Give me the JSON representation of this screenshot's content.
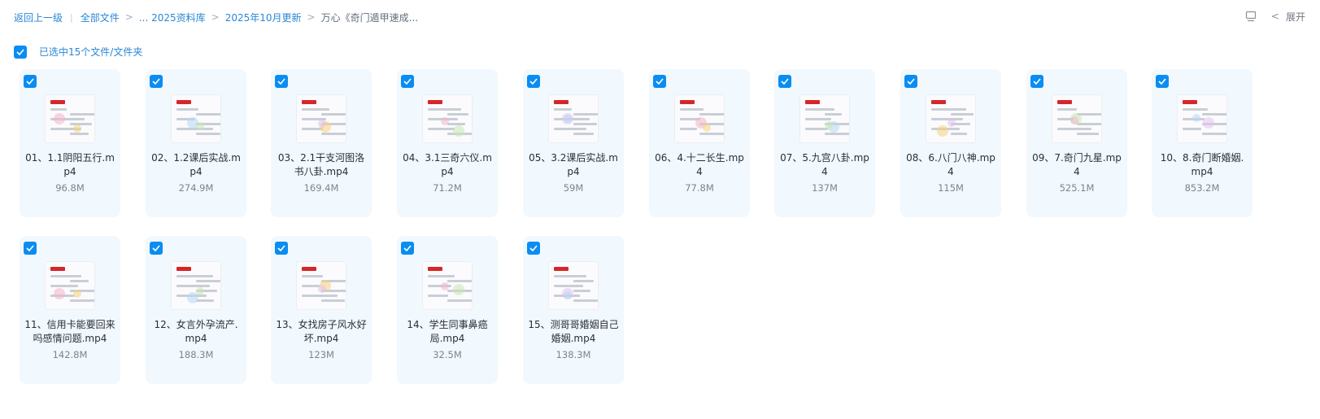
{
  "breadcrumb": {
    "back": "返回上一级",
    "all_files": "全部文件",
    "level1": "... 2025资料库",
    "level2": "2025年10月更新",
    "current": "万心《奇门遁甲速成..."
  },
  "toolbar": {
    "expand_label": "展开"
  },
  "selection": {
    "label": "已选中15个文件/文件夹"
  },
  "colors": {
    "accent": "#0a8df2",
    "link": "#2a86d6",
    "card_bg": "#f1f8fe"
  },
  "files": [
    {
      "name": "01、1.1阴阳五行.mp4",
      "size": "96.8M"
    },
    {
      "name": "02、1.2课后实战.mp4",
      "size": "274.9M"
    },
    {
      "name": "03、2.1干支河图洛书八卦.mp4",
      "size": "169.4M"
    },
    {
      "name": "04、3.1三奇六仪.mp4",
      "size": "71.2M"
    },
    {
      "name": "05、3.2课后实战.mp4",
      "size": "59M"
    },
    {
      "name": "06、4.十二长生.mp4",
      "size": "77.8M"
    },
    {
      "name": "07、5.九宫八卦.mp4",
      "size": "137M"
    },
    {
      "name": "08、6.八门八神.mp4",
      "size": "115M"
    },
    {
      "name": "09、7.奇门九星.mp4",
      "size": "525.1M"
    },
    {
      "name": "10、8.奇门断婚姻.mp4",
      "size": "853.2M"
    },
    {
      "name": "11、信用卡能要回来吗感情问题.mp4",
      "size": "142.8M"
    },
    {
      "name": "12、女言外孕流产.mp4",
      "size": "188.3M"
    },
    {
      "name": "13、女找房子风水好坏.mp4",
      "size": "123M"
    },
    {
      "name": "14、学生同事鼻癌局.mp4",
      "size": "32.5M"
    },
    {
      "name": "15、测哥哥婚姻自己婚姻.mp4",
      "size": "138.3M"
    }
  ]
}
